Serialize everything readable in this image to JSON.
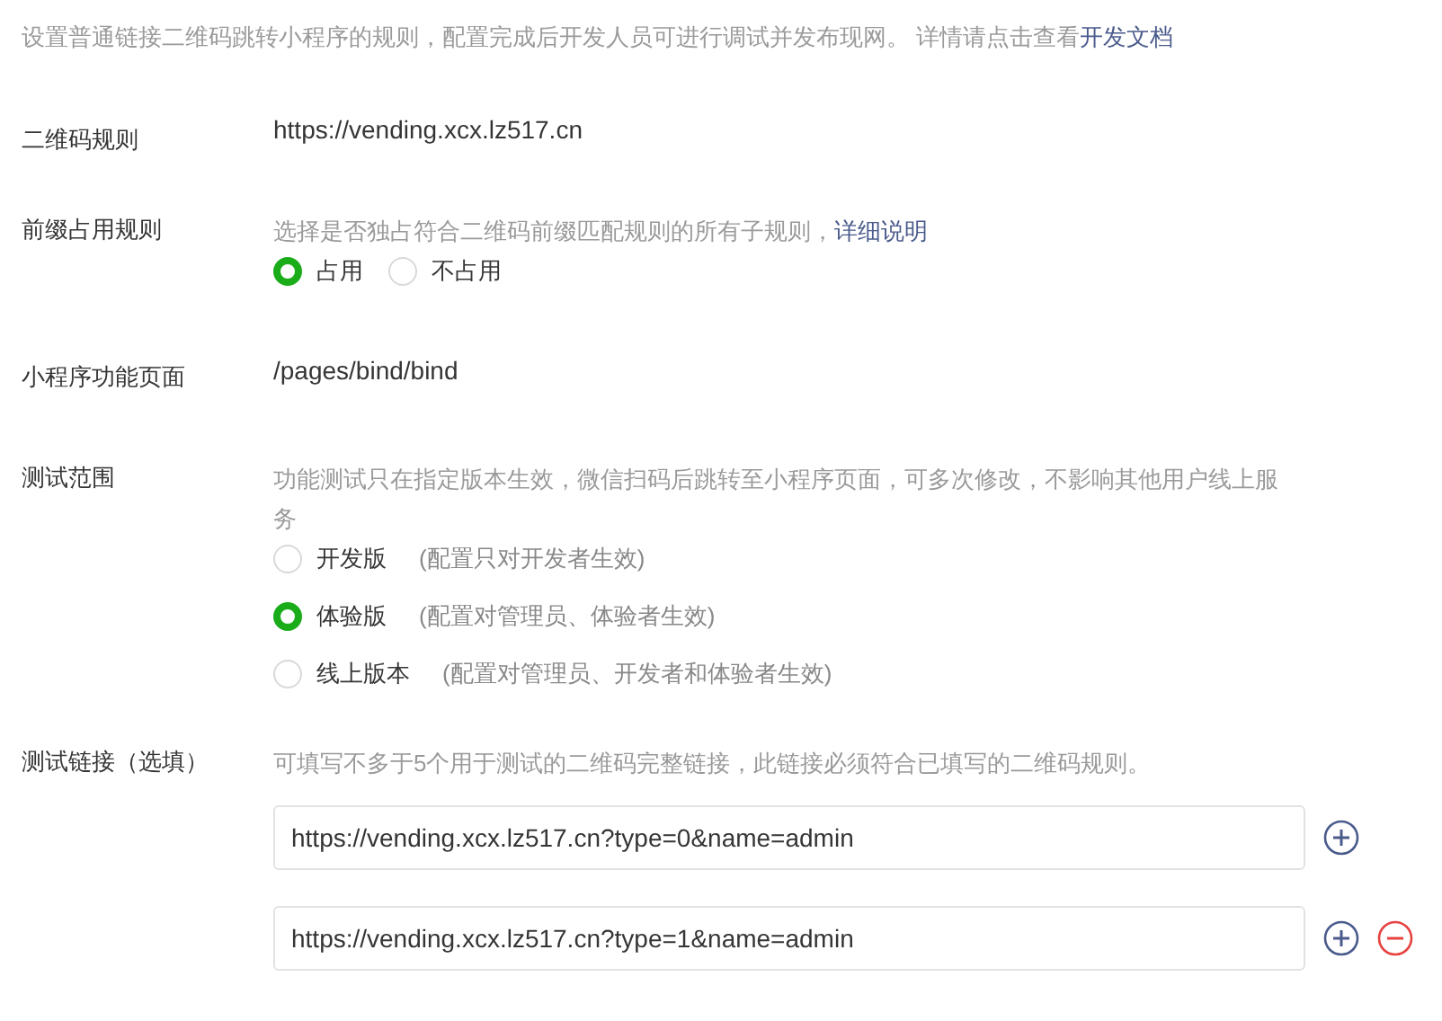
{
  "intro": {
    "text": "设置普通链接二维码跳转小程序的规则，配置完成后开发人员可进行调试并发布现网。 详情请点击查看",
    "link": "开发文档"
  },
  "qr_rule": {
    "label": "二维码规则",
    "value": "https://vending.xcx.lz517.cn"
  },
  "prefix_rule": {
    "label": "前缀占用规则",
    "hint": "选择是否独占符合二维码前缀匹配规则的所有子规则，",
    "link": "详细说明",
    "options": [
      {
        "label": "占用",
        "selected": true
      },
      {
        "label": "不占用",
        "selected": false
      }
    ]
  },
  "page": {
    "label": "小程序功能页面",
    "value": "/pages/bind/bind"
  },
  "test_scope": {
    "label": "测试范围",
    "hint": "功能测试只在指定版本生效，微信扫码后跳转至小程序页面，可多次修改，不影响其他用户线上服务",
    "options": [
      {
        "label": "开发版",
        "note": "(配置只对开发者生效)",
        "selected": false
      },
      {
        "label": "体验版",
        "note": "(配置对管理员、体验者生效)",
        "selected": true
      },
      {
        "label": "线上版本",
        "note": "(配置对管理员、开发者和体验者生效)",
        "selected": false
      }
    ]
  },
  "test_links": {
    "label": "测试链接（选填）",
    "hint": "可填写不多于5个用于测试的二维码完整链接，此链接必须符合已填写的二维码规则。",
    "links": [
      {
        "value": "https://vending.xcx.lz517.cn?type=0&name=admin",
        "removable": false
      },
      {
        "value": "https://vending.xcx.lz517.cn?type=1&name=admin",
        "removable": true
      }
    ]
  }
}
